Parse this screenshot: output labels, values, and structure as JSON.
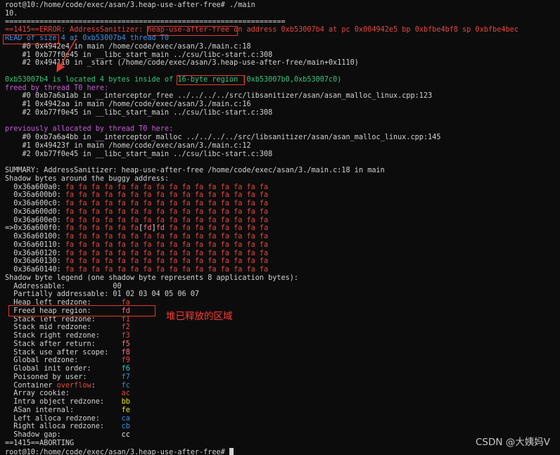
{
  "terminal": {
    "annotation_note": "堆已释放的区域",
    "watermark": "CSDN @大姨妈V",
    "lines": [
      [
        {
          "t": "root@10:/home/code/exec/asan/3.heap-use-after-free# ./main"
        }
      ],
      [
        {
          "t": "10."
        }
      ],
      [
        {
          "t": "================================================================="
        }
      ],
      [
        {
          "t": "==1415==ERROR: AddressSanitizer: ",
          "c": "red"
        },
        {
          "t": "heap-use-after-free",
          "c": "red"
        },
        {
          "t": " on address 0xb53007b4 at pc 0x004942e5 bp 0xbfbe4bf8 sp 0xbfbe4bec",
          "c": "red"
        }
      ],
      [
        {
          "t": "READ of size 4 at 0xb53007b4 thread T0",
          "c": "blue"
        }
      ],
      [
        {
          "t": "    #0 0x4942e4 in main /home/code/exec/asan/3./main.c:18"
        }
      ],
      [
        {
          "t": "    #1 0xb77f0e45 in __libc_start_main ../csu/libc-start.c:308"
        }
      ],
      [
        {
          "t": "    #2 0x494110 in _start (/home/code/exec/asan/3.heap-use-after-free/main+0x1110)"
        }
      ],
      [
        {
          "t": ""
        }
      ],
      [
        {
          "t": "0xb53007b4 is located 4 bytes inside of ",
          "c": "green"
        },
        {
          "t": "16-byte region",
          "c": "green"
        },
        {
          "t": " [0xb53007b0,0xb53007c0)",
          "c": "green"
        }
      ],
      [
        {
          "t": "freed by thread T0 here:",
          "c": "magenta"
        }
      ],
      [
        {
          "t": "    #0 0xb7a6a1ab in __interceptor_free ../../../../src/libsanitizer/asan/asan_malloc_linux.cpp:123"
        }
      ],
      [
        {
          "t": "    #1 0x4942aa in main /home/code/exec/asan/3./main.c:16"
        }
      ],
      [
        {
          "t": "    #2 0xb77f0e45 in __libc_start_main ../csu/libc-start.c:308"
        }
      ],
      [
        {
          "t": ""
        }
      ],
      [
        {
          "t": "previously allocated by thread T0 here:",
          "c": "magenta"
        }
      ],
      [
        {
          "t": "    #0 0xb7a6a4bb in __interceptor_malloc ../../../../src/libsanitizer/asan/asan_malloc_linux.cpp:145"
        }
      ],
      [
        {
          "t": "    #1 0x49423f in main /home/code/exec/asan/3./main.c:12"
        }
      ],
      [
        {
          "t": "    #2 0xb77f0e45 in __libc_start_main ../csu/libc-start.c:308"
        }
      ],
      [
        {
          "t": ""
        }
      ],
      [
        {
          "t": "SUMMARY: AddressSanitizer: heap-use-after-free /home/code/exec/asan/3./main.c:18 in main"
        }
      ],
      [
        {
          "t": "Shadow bytes around the buggy address:"
        }
      ],
      [
        {
          "t": "  0x36a600a0: "
        },
        {
          "t": "fa fa fa fa fa fa fa fa fa fa fa fa fa fa fa fa",
          "c": "red"
        }
      ],
      [
        {
          "t": "  0x36a600b0: "
        },
        {
          "t": "fa fa fa fa fa fa fa fa fa fa fa fa fa fa fa fa",
          "c": "red"
        }
      ],
      [
        {
          "t": "  0x36a600c0: "
        },
        {
          "t": "fa fa fa fa fa fa fa fa fa fa fa fa fa fa fa fa",
          "c": "red"
        }
      ],
      [
        {
          "t": "  0x36a600d0: "
        },
        {
          "t": "fa fa fa fa fa fa fa fa fa fa fa fa fa fa fa fa",
          "c": "red"
        }
      ],
      [
        {
          "t": "  0x36a600e0: "
        },
        {
          "t": "fa fa fa fa fa fa fa fa fa fa fa fa fa fa fa fa",
          "c": "red"
        }
      ],
      [
        {
          "t": "=>0x36a600f0: "
        },
        {
          "t": "fa fa fa fa fa fa",
          "c": "red"
        },
        {
          "t": "[",
          "c": "white"
        },
        {
          "t": "fd",
          "c": "pink"
        },
        {
          "t": "]",
          "c": "white"
        },
        {
          "t": "fd",
          "c": "pink"
        },
        {
          "t": " fa fa fa fa fa fa fa fa",
          "c": "red"
        }
      ],
      [
        {
          "t": "  0x36a60100: "
        },
        {
          "t": "fa fa fa fa fa fa fa fa fa fa fa fa fa fa fa fa",
          "c": "red"
        }
      ],
      [
        {
          "t": "  0x36a60110: "
        },
        {
          "t": "fa fa fa fa fa fa fa fa fa fa fa fa fa fa fa fa",
          "c": "red"
        }
      ],
      [
        {
          "t": "  0x36a60120: "
        },
        {
          "t": "fa fa fa fa fa fa fa fa fa fa fa fa fa fa fa fa",
          "c": "red"
        }
      ],
      [
        {
          "t": "  0x36a60130: "
        },
        {
          "t": "fa fa fa fa fa fa fa fa fa fa fa fa fa fa fa fa",
          "c": "red"
        }
      ],
      [
        {
          "t": "  0x36a60140: "
        },
        {
          "t": "fa fa fa fa fa fa fa fa fa fa fa fa fa fa fa fa",
          "c": "red"
        }
      ],
      [
        {
          "t": "Shadow byte legend (one shadow byte represents 8 application bytes):"
        }
      ],
      [
        {
          "t": "  Addressable:           00"
        }
      ],
      [
        {
          "t": "  Partially addressable: 01 02 03 04 05 06 07"
        }
      ],
      [
        {
          "t": "  Heap left redzone:       "
        },
        {
          "t": "fa",
          "c": "red"
        }
      ],
      [
        {
          "t": "  Freed heap region:       "
        },
        {
          "t": "fd",
          "c": "pink"
        }
      ],
      [
        {
          "t": "  Stack left redzone:      "
        },
        {
          "t": "f1",
          "c": "red"
        }
      ],
      [
        {
          "t": "  Stack mid redzone:       "
        },
        {
          "t": "f2",
          "c": "red"
        }
      ],
      [
        {
          "t": "  Stack right redzone:     "
        },
        {
          "t": "f3",
          "c": "red"
        }
      ],
      [
        {
          "t": "  Stack after return:      "
        },
        {
          "t": "f5",
          "c": "pink"
        }
      ],
      [
        {
          "t": "  Stack use after scope:   "
        },
        {
          "t": "f8",
          "c": "pink"
        }
      ],
      [
        {
          "t": "  Global redzone:          "
        },
        {
          "t": "f9",
          "c": "red"
        }
      ],
      [
        {
          "t": "  Global init order:       "
        },
        {
          "t": "f6",
          "c": "cyan"
        }
      ],
      [
        {
          "t": "  Poisoned by user:        "
        },
        {
          "t": "f7",
          "c": "blue"
        }
      ],
      [
        {
          "t": "  Container "
        },
        {
          "t": "overflow",
          "c": "red"
        },
        {
          "t": ":      "
        },
        {
          "t": "fc",
          "c": "blue"
        }
      ],
      [
        {
          "t": "  Array cookie:            "
        },
        {
          "t": "ac",
          "c": "red"
        }
      ],
      [
        {
          "t": "  Intra object redzone:    "
        },
        {
          "t": "bb",
          "c": "yellow"
        }
      ],
      [
        {
          "t": "  ASan internal:           "
        },
        {
          "t": "fe",
          "c": "yellow"
        }
      ],
      [
        {
          "t": "  Left alloca redzone:     "
        },
        {
          "t": "ca",
          "c": "blue"
        }
      ],
      [
        {
          "t": "  Right alloca redzone:    "
        },
        {
          "t": "cb",
          "c": "blue"
        }
      ],
      [
        {
          "t": "  Shadow gap:              "
        },
        {
          "t": "cc",
          "c": "white"
        }
      ],
      [
        {
          "t": "==1415==ABORTING"
        }
      ],
      [
        {
          "t": "root@10:/home/code/exec/asan/3.heap-use-after-free# "
        }
      ]
    ]
  }
}
